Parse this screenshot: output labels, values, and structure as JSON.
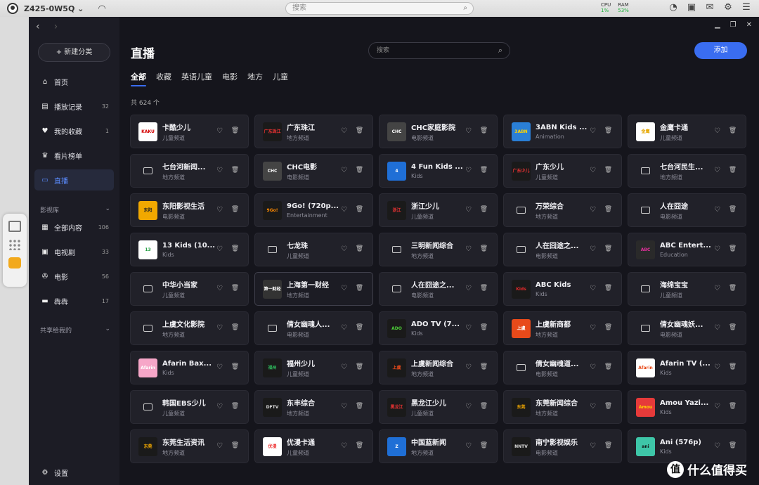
{
  "os": {
    "device_name": "Z425-0W5Q ⌄",
    "search_placeholder": "搜索",
    "cpu_label": "CPU",
    "cpu_value": "1%",
    "ram_label": "RAM",
    "ram_value": "53%"
  },
  "sidebar": {
    "new_category": "+ 新建分类",
    "items": [
      {
        "label": "首页",
        "count": ""
      },
      {
        "label": "播放记录",
        "count": "32"
      },
      {
        "label": "我的收藏",
        "count": "1"
      },
      {
        "label": "看片榜单",
        "count": ""
      },
      {
        "label": "直播",
        "count": ""
      }
    ],
    "library_title": "影视库",
    "library": [
      {
        "label": "全部内容",
        "count": "106"
      },
      {
        "label": "电视剧",
        "count": "33"
      },
      {
        "label": "电影",
        "count": "56"
      },
      {
        "label": "犇犇",
        "count": "17"
      }
    ],
    "shared_title": "共享给我的",
    "settings": "设置"
  },
  "main": {
    "title": "直播",
    "search_placeholder": "搜索",
    "add_label": "添加",
    "tabs": [
      "全部",
      "收藏",
      "英语儿童",
      "电影",
      "地方",
      "儿童"
    ],
    "total": "共 624 个"
  },
  "channels": [
    {
      "name": "卡酷少儿",
      "cat": "儿童频道",
      "logo": "KAKU",
      "bg": "#ffffff",
      "fg": "#d40000"
    },
    {
      "name": "广东珠江",
      "cat": "地方频道",
      "logo": "广东珠江",
      "bg": "#1a1a1a",
      "fg": "#e33"
    },
    {
      "name": "CHC家庭影院",
      "cat": "电影频道",
      "logo": "CHC",
      "bg": "#444",
      "fg": "#fff"
    },
    {
      "name": "3ABN Kids ...",
      "cat": "Animation",
      "logo": "3ABN",
      "bg": "#2a7fd6",
      "fg": "#ffd400"
    },
    {
      "name": "金鹰卡通",
      "cat": "儿童频道",
      "logo": "金鹰",
      "bg": "#ffffff",
      "fg": "#e6a700"
    },
    {
      "name": "七台河新闻...",
      "cat": "地方频道",
      "logo": "",
      "bg": "",
      "fg": ""
    },
    {
      "name": "CHC电影",
      "cat": "电影频道",
      "logo": "CHC",
      "bg": "#444",
      "fg": "#fff"
    },
    {
      "name": "4 Fun Kids ...",
      "cat": "Kids",
      "logo": "4",
      "bg": "#1f6fd6",
      "fg": "#fff"
    },
    {
      "name": "广东少儿",
      "cat": "儿童频道",
      "logo": "广东少儿",
      "bg": "#1a1a1a",
      "fg": "#e33"
    },
    {
      "name": "七台河民生...",
      "cat": "地方频道",
      "logo": "",
      "bg": "",
      "fg": ""
    },
    {
      "name": "东阳影视生活",
      "cat": "电影频道",
      "logo": "东阳",
      "bg": "#f1a800",
      "fg": "#222"
    },
    {
      "name": "9Go! (720p...",
      "cat": "Entertainment",
      "logo": "9Go!",
      "bg": "#1a1a1a",
      "fg": "#ff8a00"
    },
    {
      "name": "浙江少儿",
      "cat": "儿童频道",
      "logo": "浙江",
      "bg": "#1a1a1a",
      "fg": "#e33"
    },
    {
      "name": "万荣综合",
      "cat": "地方频道",
      "logo": "",
      "bg": "",
      "fg": ""
    },
    {
      "name": "人在囧途",
      "cat": "电影频道",
      "logo": "",
      "bg": "",
      "fg": ""
    },
    {
      "name": "13 Kids (10...",
      "cat": "Kids",
      "logo": "13",
      "bg": "#ffffff",
      "fg": "#1a9b3a"
    },
    {
      "name": "七龙珠",
      "cat": "儿童频道",
      "logo": "",
      "bg": "",
      "fg": ""
    },
    {
      "name": "三明新闻综合",
      "cat": "地方频道",
      "logo": "",
      "bg": "",
      "fg": ""
    },
    {
      "name": "人在囧途之...",
      "cat": "电影频道",
      "logo": "",
      "bg": "",
      "fg": ""
    },
    {
      "name": "ABC Entert...",
      "cat": "Education",
      "logo": "ABC",
      "bg": "#2a2a2a",
      "fg": "#e0319a"
    },
    {
      "name": "中华小当家",
      "cat": "儿童频道",
      "logo": "",
      "bg": "",
      "fg": ""
    },
    {
      "name": "上海第一财经",
      "cat": "地方频道",
      "logo": "第一财经",
      "bg": "#333",
      "fg": "#fff"
    },
    {
      "name": "人在囧途之...",
      "cat": "电影频道",
      "logo": "",
      "bg": "",
      "fg": ""
    },
    {
      "name": "ABC Kids",
      "cat": "Kids",
      "logo": "Kids",
      "bg": "#1a1a1a",
      "fg": "#e32a2a"
    },
    {
      "name": "海绵宝宝",
      "cat": "儿童频道",
      "logo": "",
      "bg": "",
      "fg": ""
    },
    {
      "name": "上虞文化影院",
      "cat": "地方频道",
      "logo": "",
      "bg": "",
      "fg": ""
    },
    {
      "name": "倩女幽魂人...",
      "cat": "电影频道",
      "logo": "",
      "bg": "",
      "fg": ""
    },
    {
      "name": "ADO TV (7...",
      "cat": "Kids",
      "logo": "ADO",
      "bg": "#1a1a1a",
      "fg": "#4cd137"
    },
    {
      "name": "上虞新商都",
      "cat": "地方频道",
      "logo": "上虞",
      "bg": "#e84a1a",
      "fg": "#fff"
    },
    {
      "name": "倩女幽魂妖...",
      "cat": "电影频道",
      "logo": "",
      "bg": "",
      "fg": ""
    },
    {
      "name": "Afarin Bax...",
      "cat": "Kids",
      "logo": "Afarin",
      "bg": "#f6a6c8",
      "fg": "#fff"
    },
    {
      "name": "福州少儿",
      "cat": "儿童频道",
      "logo": "福州",
      "bg": "#1a1a1a",
      "fg": "#2eb85c"
    },
    {
      "name": "上虞新闻综合",
      "cat": "地方频道",
      "logo": "上虞",
      "bg": "#1a1a1a",
      "fg": "#e84a1a"
    },
    {
      "name": "倩女幽魂道...",
      "cat": "电影频道",
      "logo": "",
      "bg": "",
      "fg": ""
    },
    {
      "name": "Afarin TV (...",
      "cat": "Kids",
      "logo": "Afarin",
      "bg": "#ffffff",
      "fg": "#e84a1a"
    },
    {
      "name": "韩国EBS少儿",
      "cat": "儿童频道",
      "logo": "",
      "bg": "",
      "fg": ""
    },
    {
      "name": "东丰综合",
      "cat": "地方频道",
      "logo": "DFTV",
      "bg": "#1a1a1a",
      "fg": "#ddd"
    },
    {
      "name": "黑龙江少儿",
      "cat": "儿童频道",
      "logo": "黑龙江",
      "bg": "#1a1a1a",
      "fg": "#e33"
    },
    {
      "name": "东莞新闻综合",
      "cat": "地方频道",
      "logo": "东莞",
      "bg": "#1a1a1a",
      "fg": "#f1a800"
    },
    {
      "name": "Amou Yazi...",
      "cat": "Kids",
      "logo": "Amou",
      "bg": "#e63a3a",
      "fg": "#ffd400"
    },
    {
      "name": "东莞生活资讯",
      "cat": "地方频道",
      "logo": "东莞",
      "bg": "#1a1a1a",
      "fg": "#f1a800"
    },
    {
      "name": "优漫卡通",
      "cat": "儿童频道",
      "logo": "优漫",
      "bg": "#ffffff",
      "fg": "#e33"
    },
    {
      "name": "中国蓝新闻",
      "cat": "地方频道",
      "logo": "Z",
      "bg": "#1f6fd6",
      "fg": "#fff"
    },
    {
      "name": "南宁影视娱乐",
      "cat": "电影频道",
      "logo": "NNTV",
      "bg": "#1a1a1a",
      "fg": "#ddd"
    },
    {
      "name": "Ani (576p)",
      "cat": "Kids",
      "logo": "ani",
      "bg": "#3ec6a8",
      "fg": "#111"
    }
  ],
  "watermark": "什么值得买"
}
